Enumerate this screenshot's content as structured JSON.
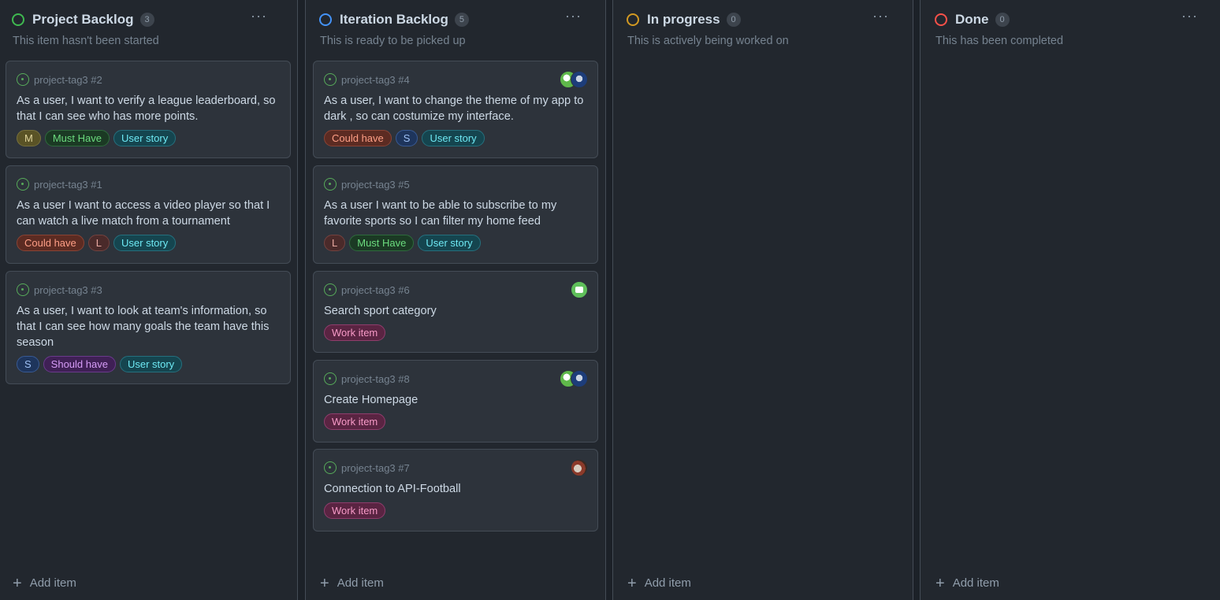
{
  "columns": [
    {
      "title": "Project Backlog",
      "count": "3",
      "description": "This item hasn't been started",
      "status_color": "#3fb950",
      "menu": "···",
      "add_label": "Add item",
      "cards": [
        {
          "repo": "project-tag3 #2",
          "title": "As a user, I want to verify a league leaderboard, so that I can see who has more points.",
          "labels": [
            "M",
            "Must Have",
            "User story"
          ],
          "avatars": []
        },
        {
          "repo": "project-tag3 #1",
          "title": "As a user I want to access a video player so that I can watch a live match from a tournament",
          "labels": [
            "Could have",
            "L",
            "User story"
          ],
          "avatars": []
        },
        {
          "repo": "project-tag3 #3",
          "title": "As a user, I want to look at team's information, so that I can see how many goals the team have this season",
          "labels": [
            "S",
            "Should have",
            "User story"
          ],
          "avatars": []
        }
      ]
    },
    {
      "title": "Iteration Backlog",
      "count": "5",
      "description": "This is ready to be picked up",
      "status_color": "#4493f8",
      "menu": "···",
      "add_label": "Add item",
      "cards": [
        {
          "repo": "project-tag3 #4",
          "title": "As a user, I want to change the theme of my app to dark , so can costumize my interface.",
          "labels": [
            "Could have",
            "S",
            "User story"
          ],
          "avatars": [
            "green-avatar",
            "blue-avatar"
          ]
        },
        {
          "repo": "project-tag3 #5",
          "title": "As a user I want to be able to subscribe to my favorite sports so I can filter my home feed",
          "labels": [
            "L",
            "Must Have",
            "User story"
          ],
          "avatars": []
        },
        {
          "repo": "project-tag3 #6",
          "title": "Search sport category",
          "labels": [
            "Work item"
          ],
          "avatars": [
            "bot-avatar"
          ]
        },
        {
          "repo": "project-tag3 #8",
          "title": "Create Homepage",
          "labels": [
            "Work item"
          ],
          "avatars": [
            "green-avatar",
            "blue-avatar"
          ]
        },
        {
          "repo": "project-tag3 #7",
          "title": "Connection to API-Football",
          "labels": [
            "Work item"
          ],
          "avatars": [
            "brown-avatar"
          ]
        }
      ]
    },
    {
      "title": "In progress",
      "count": "0",
      "description": "This is actively being worked on",
      "status_color": "#d29922",
      "menu": "···",
      "add_label": "Add item",
      "cards": []
    },
    {
      "title": "Done",
      "count": "0",
      "description": "This has been completed",
      "status_color": "#f85149",
      "menu": "···",
      "add_label": "Add item",
      "cards": []
    }
  ],
  "icons": {
    "status": "status-ring-icon",
    "issue": "issue-open-icon",
    "add": "plus-icon",
    "menu": "kebab-menu-icon"
  }
}
